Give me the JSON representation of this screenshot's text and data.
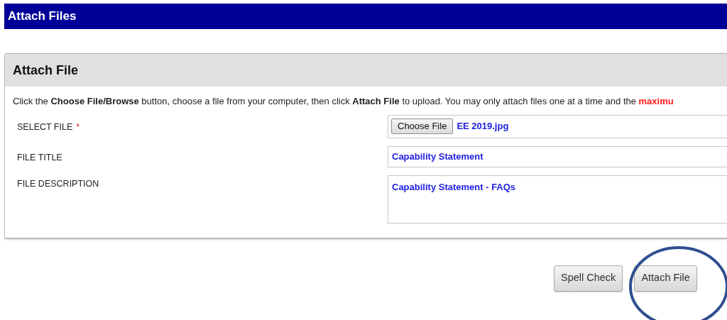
{
  "page_title": "Attach Files",
  "panel": {
    "title": "Attach File",
    "instructions": {
      "text": "Click the **Choose File/Browse** button, choose a file from your computer, then click **Attach File** to upload. You may only attach files one at a time and the ",
      "warning": "maximu"
    },
    "fields": [
      {
        "kind": "file",
        "label": "SELECT FILE",
        "required_mark": "*",
        "button": "Choose File",
        "value": "EE 2019.jpg"
      },
      {
        "kind": "text",
        "label": "FILE TITLE",
        "value": "Capability Statement"
      },
      {
        "kind": "textarea",
        "label": "FILE DESCRIPTION",
        "value": "Capability Statement - FAQs"
      }
    ]
  },
  "buttons": [
    {
      "label": "Spell Check"
    },
    {
      "label": "Attach File"
    }
  ],
  "annotations": [
    {
      "kind": "ellipse"
    }
  ]
}
